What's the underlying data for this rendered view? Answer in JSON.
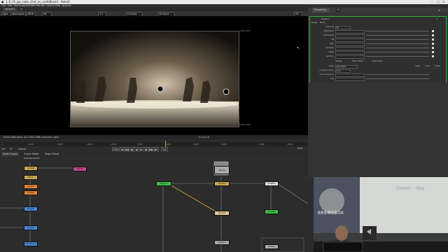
{
  "window": {
    "title": "1_6_01_go_nuke_shot_on_nodeBased - NukeX",
    "controls": [
      "–",
      "□",
      "✕"
    ]
  },
  "menubar": {
    "items": [
      "File",
      "Edit",
      "Workspace",
      "Viewer",
      "Render",
      "Cache",
      "Help",
      "gizmos"
    ]
  },
  "viewer": {
    "tab_label": "Viewer1",
    "toolbar": {
      "channels": "rgba",
      "layer": "rgba.alpha",
      "colorspace": "sRGB",
      "gain": "f/8",
      "zoom": "1:1",
      "input_a": "A Read1",
      "input_b": "B Read1",
      "mode": "2D"
    },
    "frame_res_label": "1920x1080",
    "frame_format_label": "1920x1080",
    "info_left": "1920x1080 bbox: 0 0 1920 1080 channels: rgba",
    "info_right": "x=0 y=0"
  },
  "timeline": {
    "fps": "24*",
    "mode": "TF",
    "range": "Global",
    "ticks": [
      "1",
      "1000",
      "1050",
      "1100",
      "1150",
      "1200",
      "1250",
      "1300",
      "1350",
      "1400",
      "1450"
    ],
    "current_frame": "1193",
    "end_frame": "1500",
    "transport": [
      "|◀",
      "◀◀",
      "◀|",
      "◀",
      "▶",
      "|▶",
      "▶▶",
      "▶|"
    ],
    "step": "10"
  },
  "nodegraph": {
    "tabs": [
      "Node Graph",
      "Curve Editor",
      "Dope Sheet"
    ],
    "backdrop_label": "DAYFIRE NODES",
    "nodes": [
      {
        "id": "n1",
        "label": "Read3"
      },
      {
        "id": "n2",
        "label": "Grade4"
      },
      {
        "id": "n3",
        "label": "Blur1"
      },
      {
        "id": "n4",
        "label": "Grade1"
      },
      {
        "id": "n5",
        "label": "Merge1"
      },
      {
        "id": "n6",
        "label": "Merge2"
      },
      {
        "id": "n7",
        "label": "Transform1"
      },
      {
        "id": "n8",
        "label": "Viewer1"
      },
      {
        "id": "n9",
        "label": "Read1"
      },
      {
        "id": "n10",
        "label": "Shuffle1"
      },
      {
        "id": "n11",
        "label": "Grade5"
      },
      {
        "id": "n12",
        "label": "Merge3"
      },
      {
        "id": "n13",
        "label": "Write1"
      },
      {
        "id": "n14",
        "label": "Keyer1"
      },
      {
        "id": "n15",
        "label": "Dot"
      },
      {
        "id": "n16",
        "label": "Grade2"
      },
      {
        "id": "n17",
        "label": "Grade3"
      }
    ],
    "read_thumb_label": "Read1\nsequence"
  },
  "properties": {
    "header_title": "Properties",
    "header_count": "10",
    "node_name": "Grade1",
    "tabs": [
      "Grade",
      "Node"
    ],
    "channels_label": "channels",
    "channels_value": "rgb",
    "rows": [
      {
        "label": "blackpoint"
      },
      {
        "label": "whitepoint"
      },
      {
        "label": "lift"
      },
      {
        "label": "gain"
      },
      {
        "label": "multiply"
      },
      {
        "label": "offset"
      },
      {
        "label": "gamma"
      }
    ],
    "checks": [
      "reverse",
      "black clamp",
      "white clamp"
    ],
    "mask_label": "mask",
    "mask_value": "rgba.alpha",
    "mask_checks": [
      "inject",
      "invert",
      "fringe"
    ],
    "unpremult_label": "(un)premult by",
    "unpremult_value": "none",
    "mix_luminance_label": "mix luminance",
    "mix_label": "mix",
    "footer": "Grade1"
  },
  "webcam": {
    "logo": "BREMSBOX",
    "whiteboard_text": "Green - Sky"
  },
  "colors": {
    "accent": "#2fae3c",
    "playhead": "#e8a02a",
    "node_grade": "#c8a84e",
    "node_merge": "#4a8ad8",
    "node_read": "#aaaaaa",
    "node_green": "#3cbf4a",
    "node_pink": "#c84a8a",
    "node_orange": "#e0873a"
  }
}
